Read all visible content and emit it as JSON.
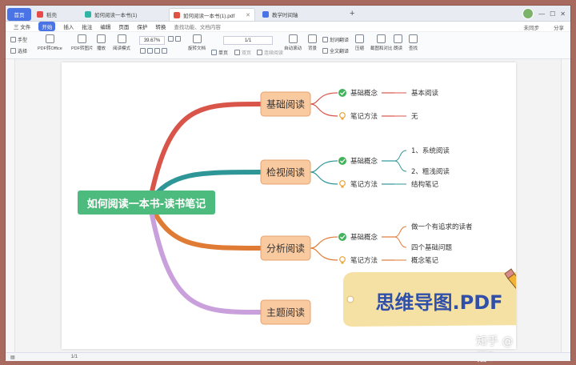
{
  "tabs": {
    "home": "首页",
    "docer": "稻壳",
    "tab2": "如何阅读一本书(1)",
    "tab3": "如何阅读一本书(1).pdf",
    "tab4": "教学时间轴"
  },
  "menu": {
    "file": "三 文件",
    "items": [
      "开始",
      "插入",
      "批注",
      "编辑",
      "页面",
      "保护",
      "转换"
    ],
    "search": "查找功能、文档内容",
    "right_sync": "未同步",
    "right_share": "分享"
  },
  "ribbon": {
    "hand": "手型",
    "select": "选择",
    "pdf_office": "PDF转Office",
    "pdf_image": "PDF转图片",
    "play": "播放",
    "read_mode": "阅读模式",
    "zoom": "39.67%",
    "rotate": "旋转文档",
    "single": "单页",
    "double": "双页",
    "continuous": "连续阅读",
    "auto_scroll": "自动滚动",
    "background": "背景",
    "translate": "划词翻译",
    "full_translate": "全文翻译",
    "compress": "压缩",
    "screenshot": "截图和对比",
    "read_aloud": "朗读",
    "find": "查找",
    "page": "1/1"
  },
  "mindmap": {
    "center": "如何阅读一本书-读书笔记",
    "branches": [
      {
        "title": "基础阅读",
        "color": "#d9554a",
        "concept_label": "基础概念",
        "concept_items": [
          "基本阅读"
        ],
        "notes_label": "笔记方法",
        "notes_items": [
          "无"
        ]
      },
      {
        "title": "检视阅读",
        "color": "#2f9698",
        "concept_label": "基础概念",
        "concept_items": [
          "1、系统阅读",
          "2、粗浅阅读"
        ],
        "notes_label": "笔记方法",
        "notes_items": [
          "结构笔记"
        ]
      },
      {
        "title": "分析阅读",
        "color": "#e07b35",
        "concept_label": "基础概念",
        "concept_items": [
          "做一个有追求的读者",
          "四个基础问题"
        ],
        "notes_label": "笔记方法",
        "notes_items": [
          "概念笔记"
        ]
      },
      {
        "title": "主题阅读",
        "color": "#c9a0dc"
      }
    ],
    "sticker": "思维导图.PDF"
  },
  "watermark": "知乎 @悟D",
  "status": {
    "page": "1/1"
  },
  "colors": {
    "accent": "#4a74e6",
    "center": "#4dbb7e",
    "node_fill": "#f9c9a0",
    "node_border": "#e6a36f"
  }
}
